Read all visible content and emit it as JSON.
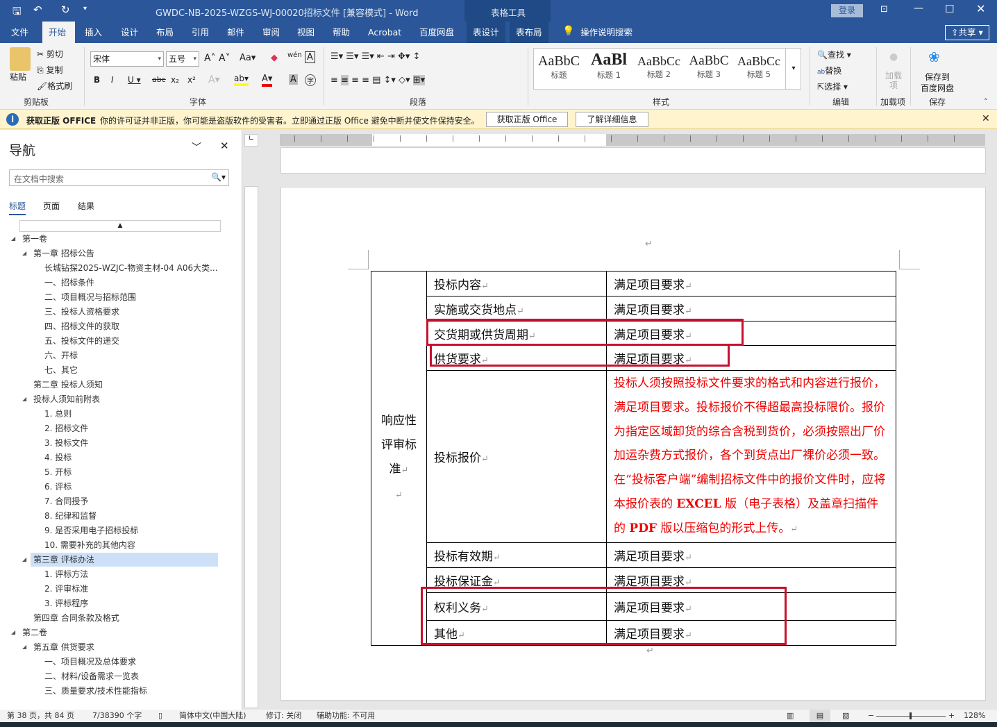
{
  "title": {
    "doc": "GWDC-NB-2025-WZGS-WJ-00020招标文件 [兼容模式]  -  Word",
    "context": "表格工具",
    "login": "登录"
  },
  "tabs": [
    "文件",
    "开始",
    "插入",
    "设计",
    "布局",
    "引用",
    "邮件",
    "审阅",
    "视图",
    "帮助",
    "Acrobat",
    "百度网盘",
    "表设计",
    "表布局"
  ],
  "tell_me": "操作说明搜索",
  "share": "共享",
  "ribbon": {
    "clipboard": {
      "paste": "粘贴",
      "cut": "剪切",
      "copy": "复制",
      "painter": "格式刷",
      "label": "剪贴板"
    },
    "font": {
      "name": "宋体",
      "size": "五号",
      "label": "字体"
    },
    "paragraph": {
      "label": "段落"
    },
    "styles": {
      "items": [
        {
          "sample": "AaBbC",
          "name": "标题"
        },
        {
          "sample": "AaBl",
          "name": "标题 1"
        },
        {
          "sample": "AaBbCc",
          "name": "标题 2"
        },
        {
          "sample": "AaBbC",
          "name": "标题 3"
        },
        {
          "sample": "AaBbCc",
          "name": "标题 5"
        }
      ],
      "label": "样式"
    },
    "editing": {
      "find": "查找",
      "replace": "替换",
      "select": "选择",
      "label": "编辑"
    },
    "addins": {
      "btn": "加载项",
      "label": "加载项"
    },
    "save": {
      "btn1": "保存到",
      "btn2": "百度网盘",
      "label": "保存"
    }
  },
  "warning": {
    "title": "获取正版 OFFICE",
    "text": "你的许可证并非正版，你可能是盗版软件的受害者。立即通过正版 Office 避免中断并使文件保持安全。",
    "btn1": "获取正版 Office",
    "btn2": "了解详细信息"
  },
  "nav": {
    "title": "导航",
    "search_placeholder": "在文档中搜索",
    "tabs": [
      "标题",
      "页面",
      "结果"
    ],
    "items": [
      {
        "t": "第一卷",
        "l": 0,
        "e": true
      },
      {
        "t": "第一章  招标公告",
        "l": 1,
        "e": true
      },
      {
        "t": "长城钻探2025-WZJC-物资主材-04 A06大类...",
        "l": 2
      },
      {
        "t": "一、招标条件",
        "l": 2
      },
      {
        "t": "二、项目概况与招标范围",
        "l": 2
      },
      {
        "t": "三、投标人资格要求",
        "l": 2
      },
      {
        "t": "四、招标文件的获取",
        "l": 2
      },
      {
        "t": "五、投标文件的递交",
        "l": 2
      },
      {
        "t": "六、开标",
        "l": 2
      },
      {
        "t": "七、其它",
        "l": 2
      },
      {
        "t": "第二章  投标人须知",
        "l": 1
      },
      {
        "t": "投标人须知前附表",
        "l": 1,
        "e": true
      },
      {
        "t": "1. 总则",
        "l": 2
      },
      {
        "t": "2. 招标文件",
        "l": 2
      },
      {
        "t": "3. 投标文件",
        "l": 2
      },
      {
        "t": "4. 投标",
        "l": 2
      },
      {
        "t": "5. 开标",
        "l": 2
      },
      {
        "t": "6. 评标",
        "l": 2
      },
      {
        "t": "7. 合同授予",
        "l": 2
      },
      {
        "t": "8. 纪律和监督",
        "l": 2
      },
      {
        "t": "9. 是否采用电子招标投标",
        "l": 2
      },
      {
        "t": "10. 需要补充的其他内容",
        "l": 2
      },
      {
        "t": "第三章  评标办法",
        "l": 1,
        "e": true,
        "sel": true
      },
      {
        "t": "1. 评标方法",
        "l": 2
      },
      {
        "t": "2. 评审标准",
        "l": 2
      },
      {
        "t": "3. 评标程序",
        "l": 2
      },
      {
        "t": "第四章  合同条款及格式",
        "l": 1
      },
      {
        "t": "第二卷",
        "l": 0,
        "e": true
      },
      {
        "t": "第五章  供货要求",
        "l": 1,
        "e": true
      },
      {
        "t": "一、项目概况及总体要求",
        "l": 2
      },
      {
        "t": "二、材料/设备需求一览表",
        "l": 2
      },
      {
        "t": "三、质量要求/技术性能指标",
        "l": 2
      }
    ]
  },
  "table": {
    "group": [
      "响应性",
      "评审标",
      "准"
    ],
    "rows": [
      {
        "k": "投标内容",
        "v": "满足项目要求"
      },
      {
        "k": "实施或交货地点",
        "v": "满足项目要求"
      },
      {
        "k": "交货期或供货周期",
        "v": "满足项目要求"
      },
      {
        "k": "供货要求",
        "v": "满足项目要求"
      },
      {
        "k": "投标报价",
        "v": ""
      },
      {
        "k": "投标有效期",
        "v": "满足项目要求"
      },
      {
        "k": "投标保证金",
        "v": "满足项目要求"
      },
      {
        "k": "权利义务",
        "v": "满足项目要求"
      },
      {
        "k": "其他",
        "v": "满足项目要求"
      }
    ],
    "price_text": {
      "a": "投标人须按照投标文件要求的格式和内容进行报价，满足项目要求。投标报价不得超最高投标限价。报价为指定区域卸货的综合含税到货价，必须按照出厂价加运杂费方式报价，各个到货点出厂裸价必须一致。在“投标客户端”编制招标文件中的报价文件时，应将本报价表的",
      "b": "EXCEL",
      "c": "版（电子表格）及盖章扫描件的",
      "d": "PDF",
      "e": "版以压缩包的形式上传。"
    }
  },
  "status": {
    "page": "第 38 页，共 84 页",
    "words": "7/38390 个字",
    "lang": "简体中文(中国大陆)",
    "track": "修订: 关闭",
    "access": "辅助功能: 不可用",
    "zoom": "128%"
  },
  "colors": {
    "brand": "#2b579a",
    "highlight_box": "#c8102e",
    "red_text": "#e00000"
  }
}
